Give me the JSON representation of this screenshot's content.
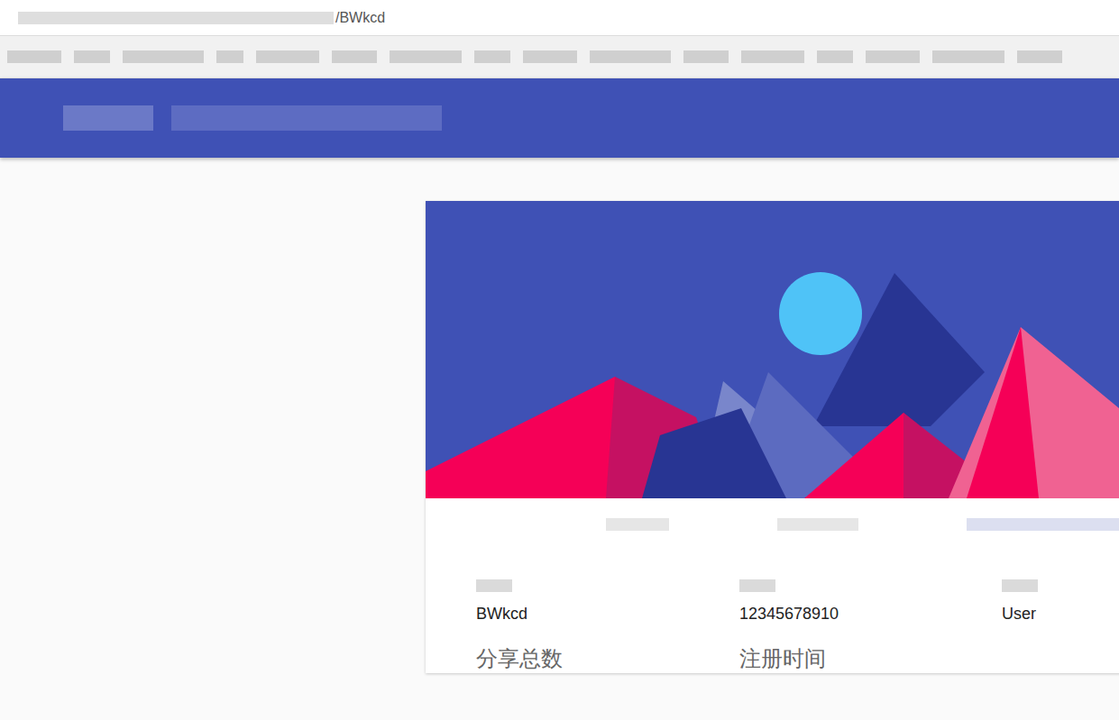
{
  "browser": {
    "address": "/BWkcd"
  },
  "profile": {
    "fields": [
      {
        "value": "BWkcd"
      },
      {
        "value": "12345678910"
      },
      {
        "value": "User"
      }
    ],
    "stats": [
      {
        "label": "分享总数"
      },
      {
        "label": "注册时间"
      }
    ]
  }
}
